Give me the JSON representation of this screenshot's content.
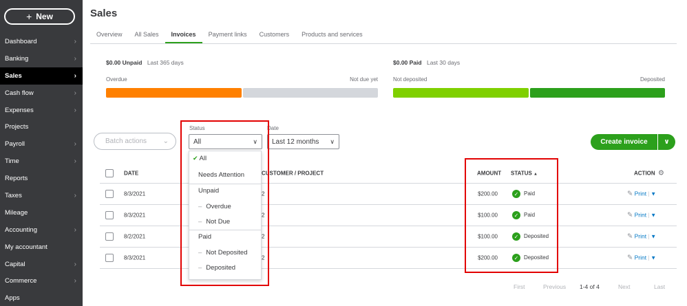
{
  "sidebar": {
    "new_button_label": "New",
    "items": [
      {
        "label": "Dashboard",
        "chevron": true
      },
      {
        "label": "Banking",
        "chevron": true
      },
      {
        "label": "Sales",
        "chevron": true,
        "active": true
      },
      {
        "label": "Cash flow",
        "chevron": true
      },
      {
        "label": "Expenses",
        "chevron": true
      },
      {
        "label": "Projects",
        "chevron": false
      },
      {
        "label": "Payroll",
        "chevron": true
      },
      {
        "label": "Time",
        "chevron": true
      },
      {
        "label": "Reports",
        "chevron": false
      },
      {
        "label": "Taxes",
        "chevron": true
      },
      {
        "label": "Mileage",
        "chevron": false
      },
      {
        "label": "Accounting",
        "chevron": true
      },
      {
        "label": "My accountant",
        "chevron": false
      },
      {
        "label": "Capital",
        "chevron": true
      },
      {
        "label": "Commerce",
        "chevron": true
      },
      {
        "label": "Apps",
        "chevron": false
      }
    ]
  },
  "page": {
    "title": "Sales",
    "tabs": [
      "Overview",
      "All Sales",
      "Invoices",
      "Payment links",
      "Customers",
      "Products and services"
    ],
    "active_tab": "Invoices"
  },
  "summary_left": {
    "amount": "$0.00 Unpaid",
    "period": "Last 365 days",
    "label_left": "Overdue",
    "label_right": "Not due yet",
    "colors": [
      "#ff8000",
      "#d4d7dc"
    ],
    "fractions": [
      0.5,
      0.5
    ]
  },
  "summary_right": {
    "amount": "$0.00 Paid",
    "period": "Last 30 days",
    "label_left": "Not deposited",
    "label_right": "Deposited",
    "colors": [
      "#7fd000",
      "#2ca01c"
    ],
    "fractions": [
      0.5,
      0.5
    ]
  },
  "controls": {
    "batch_actions": "Batch actions",
    "status_label": "Status",
    "status_value": "All",
    "date_label": "Date",
    "date_value": "Last 12 months",
    "create_invoice": "Create invoice"
  },
  "status_menu": {
    "items": [
      "All",
      "Needs Attention",
      "Unpaid",
      "Overdue",
      "Not Due",
      "Paid",
      "Not Deposited",
      "Deposited"
    ],
    "selected": "All"
  },
  "table": {
    "headers": {
      "date": "DATE",
      "customer": "CUSTOMER / PROJECT",
      "amount": "AMOUNT",
      "status": "STATUS",
      "sort_indicator": "▲",
      "action": "ACTION"
    },
    "rows": [
      {
        "date": "8/3/2021",
        "customer": "2",
        "amount": "$200.00",
        "status": "Paid",
        "action": "Print"
      },
      {
        "date": "8/3/2021",
        "customer": "2",
        "amount": "$100.00",
        "status": "Paid",
        "action": "Print"
      },
      {
        "date": "8/2/2021",
        "customer": "2",
        "amount": "$100.00",
        "status": "Deposited",
        "action": "Print"
      },
      {
        "date": "8/3/2021",
        "customer": "2",
        "amount": "$200.00",
        "status": "Deposited",
        "action": "Print"
      }
    ]
  },
  "pager": {
    "first": "First",
    "previous": "Previous",
    "range": "1-4 of 4",
    "next": "Next",
    "last": "Last"
  },
  "colors": {
    "sidebar_bg": "#393a3d",
    "accent_green": "#2ca01c",
    "link_blue": "#0077c5",
    "highlight_red": "#e20000"
  }
}
